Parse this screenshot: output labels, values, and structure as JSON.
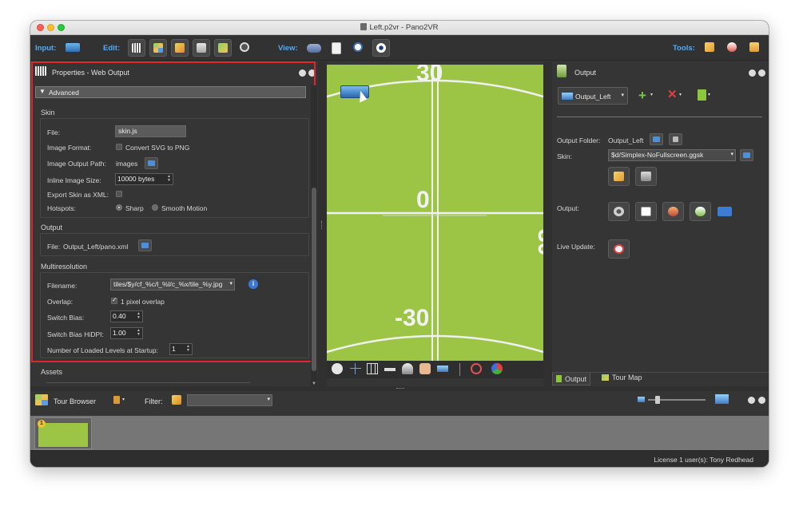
{
  "window": {
    "title": "Left.p2vr - Pano2VR"
  },
  "toolbar": {
    "input_label": "Input:",
    "edit_label": "Edit:",
    "view_label": "View:",
    "tools_label": "Tools:",
    "icons": [
      "panorama-icon",
      "keyboard-icon",
      "tour-grid-icon",
      "pencil-icon",
      "hotspot-editor-icon",
      "map-icon",
      "film-reel-icon",
      "binoculars-icon",
      "clipboard-icon",
      "clock-icon",
      "eye-icon",
      "magic-star-icon",
      "cloud-icon",
      "vr-headset-icon"
    ]
  },
  "properties": {
    "title": "Properties - Web Output",
    "advanced_label": "Advanced",
    "skin_section": "Skin",
    "file_label": "File:",
    "file_value": "skin.js",
    "image_format_label": "Image Format:",
    "convert_svg_label": "Convert SVG to PNG",
    "image_output_path_label": "Image Output Path:",
    "image_output_path_value": "images",
    "inline_image_size_label": "Inline Image Size:",
    "inline_image_size_value": "10000 bytes",
    "export_skin_xml_label": "Export Skin as XML:",
    "hotspots_label": "Hotspots:",
    "hotspots_sharp": "Sharp",
    "hotspots_smooth": "Smooth Motion",
    "output_section": "Output",
    "output_file_label": "File:",
    "output_file_value": "Output_Left/pano.xml",
    "multires_section": "Multiresolution",
    "filename_label": "Filename:",
    "filename_value": "tiles/$y/cf_%c/l_%l/c_%x/tile_%y.jpg",
    "overlap_label": "Overlap:",
    "overlap_value": "1 pixel overlap",
    "switch_bias_label": "Switch Bias:",
    "switch_bias_value": "0.40",
    "switch_bias_hidpi_label": "Switch Bias HiDPI:",
    "switch_bias_hidpi_value": "1.00",
    "loaded_levels_label": "Number of Loaded Levels at Startup:",
    "loaded_levels_value": "1",
    "assets_section": "Assets"
  },
  "viewer": {
    "label_top": "30",
    "label_center": "0",
    "label_right": "-30",
    "label_bottom": "-30",
    "bg_color": "#9cc545",
    "bottom_icons": [
      "compass-icon",
      "crosshair-icon",
      "grid-icon",
      "key-icon",
      "spotlight-icon",
      "hand-icon",
      "panorama-strip-icon",
      "target-icon",
      "color-balls-icon"
    ]
  },
  "output": {
    "title": "Output",
    "selector_label": "Output_Left",
    "output_folder_label": "Output Folder:",
    "output_folder_value": "Output_Left",
    "skin_label": "Skin:",
    "skin_value": "$d/Simplex-NoFullscreen.ggsk",
    "output_label": "Output:",
    "live_update_label": "Live Update:",
    "tab_output": "Output",
    "tab_tour_map": "Tour Map"
  },
  "tour_browser": {
    "title": "Tour Browser",
    "filter_label": "Filter:",
    "filter_value": "",
    "thumb_badge": "1"
  },
  "status": {
    "license": "License 1 user(s): Tony Redhead"
  },
  "colors": {
    "accent_blue": "#5aa9ef",
    "highlight_red": "#e0262a",
    "field_green": "#9cc545"
  }
}
